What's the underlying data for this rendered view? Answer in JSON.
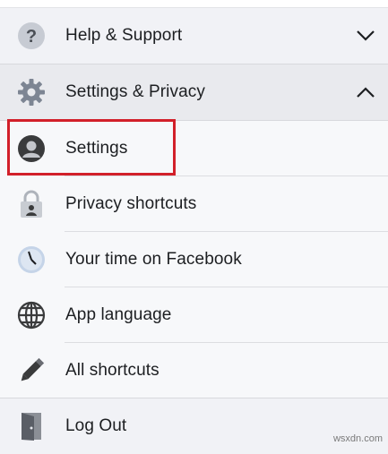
{
  "menu": {
    "help_support": {
      "label": "Help & Support",
      "icon": "question-icon",
      "expanded": false
    },
    "settings_privacy": {
      "label": "Settings & Privacy",
      "icon": "gear-icon",
      "expanded": true
    },
    "sub_items": [
      {
        "label": "Settings",
        "icon": "profile-icon",
        "highlighted": true
      },
      {
        "label": "Privacy shortcuts",
        "icon": "lock-icon"
      },
      {
        "label": "Your time on Facebook",
        "icon": "clock-icon"
      },
      {
        "label": "App language",
        "icon": "globe-icon"
      },
      {
        "label": "All shortcuts",
        "icon": "pencil-icon"
      }
    ],
    "log_out": {
      "label": "Log Out",
      "icon": "door-icon"
    }
  },
  "highlight_color": "#d2202a",
  "watermark": "wsxdn.com"
}
